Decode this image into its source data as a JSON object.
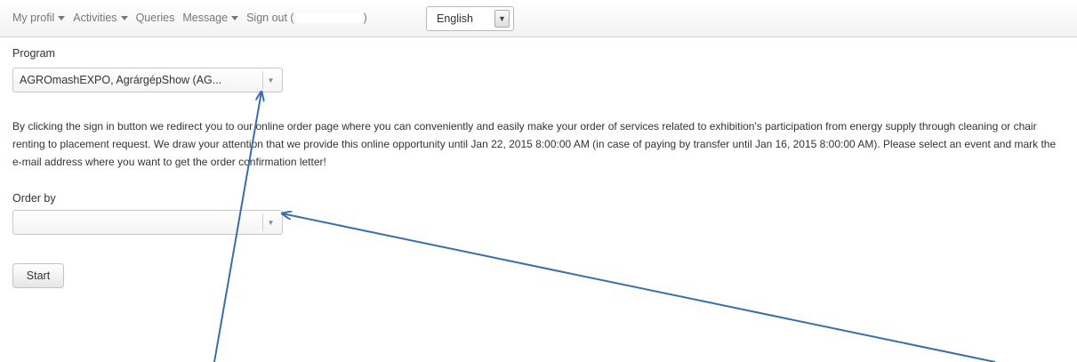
{
  "navbar": {
    "items": [
      {
        "label": "My profil",
        "has_caret": true
      },
      {
        "label": "Activities",
        "has_caret": true
      },
      {
        "label": "Queries",
        "has_caret": false
      },
      {
        "label": "Message",
        "has_caret": true
      }
    ],
    "signout_prefix": "Sign out (",
    "signout_suffix": ")",
    "language": "English"
  },
  "program": {
    "label": "Program",
    "selected": "AGROmashEXPO, AgrárgépShow (AG..."
  },
  "info_text": "By clicking the sign in button we redirect you to our online order page where you can conveniently and easily make your order of services related to exhibition's participation from energy supply through cleaning or chair renting to placement request. We draw your attention that we provide this online opportunity until Jan 22, 2015 8:00:00 AM (in case of paying by transfer until Jan 16, 2015 8:00:00 AM). Please select an event and mark the e-mail address where you want to get the order confirmation letter!",
  "order_by": {
    "label": "Order by",
    "selected": ""
  },
  "start_button": "Start",
  "colors": {
    "annotation_arrow": "#3a6ea8"
  }
}
